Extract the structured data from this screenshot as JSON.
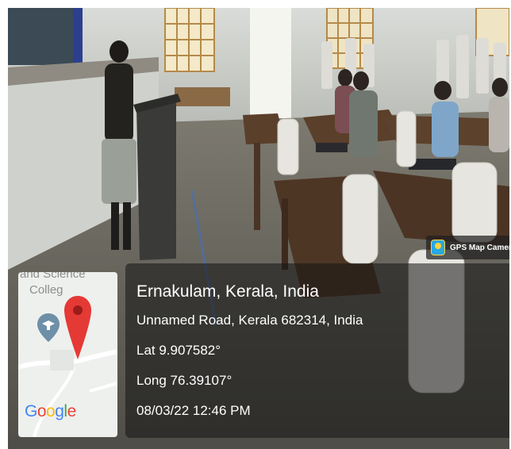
{
  "overlay": {
    "app_badge": "GPS Map Camera",
    "place": "Ernakulam, Kerala, India",
    "address": "Unnamed Road, Kerala 682314, India",
    "latitude": "Lat 9.907582°",
    "longitude": "Long 76.39107°",
    "datetime": "08/03/22 12:46 PM"
  },
  "map": {
    "label_top": "and Science",
    "label_college": "Colleg",
    "brand_letters": [
      "G",
      "o",
      "o",
      "g",
      "l",
      "e"
    ],
    "pin_color": "#e53935",
    "school_marker_color": "#6e8fa8"
  },
  "colors": {
    "overlay_bg": "#141414",
    "text": "#ffffff",
    "map_bg": "#eef0ee"
  }
}
